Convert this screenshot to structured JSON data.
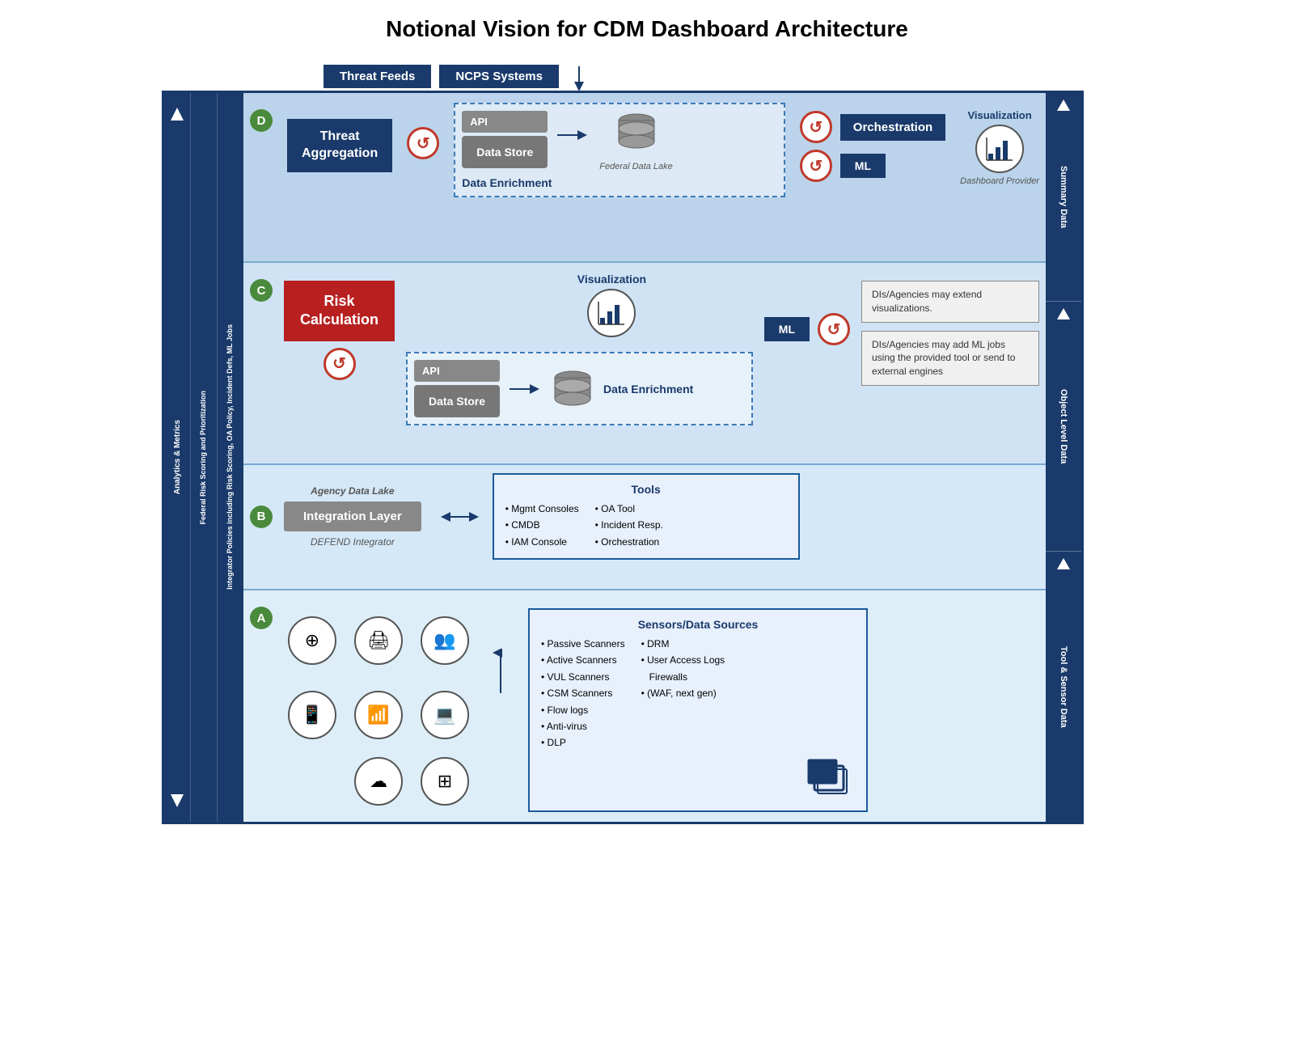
{
  "title": "Notional Vision for CDM Dashboard Architecture",
  "topFeeds": [
    {
      "label": "Threat Feeds"
    },
    {
      "label": "NCPS Systems"
    }
  ],
  "leftBars": [
    {
      "text": "Analytics & Metrics"
    },
    {
      "text": "Federal Risk Scoring and Prioritization"
    },
    {
      "text": "Integrator Policies including Risk Scoring, OA Policy, Incident Defs, ML Jobs"
    }
  ],
  "rightBars": [
    {
      "text": "Summary Data"
    },
    {
      "text": "Object Level Data"
    },
    {
      "text": "Tool & Sensor Data"
    }
  ],
  "sectionD": {
    "label": "D",
    "threatAggBox": "Threat\nAggregation",
    "apiLabel": "API",
    "dataStoreLabel": "Data\nStore",
    "dataEnrichmentLabel": "Data Enrichment",
    "orchestrationLabel": "Orchestration",
    "mlLabel": "ML",
    "federalDataLakeLabel": "Federal Data Lake",
    "visualizationLabel": "Visualization",
    "dashboardProviderLabel": "Dashboard Provider"
  },
  "sectionC": {
    "label": "C",
    "riskCalcLabel": "Risk\nCalculation",
    "visualizationLabel": "Visualization",
    "dataEnrichmentLabel": "Data Enrichment",
    "mlLabel": "ML",
    "apiLabel": "API",
    "dataStoreLabel": "Data\nStore",
    "note1": "DIs/Agencies may extend visualizations.",
    "note2": "DIs/Agencies may add ML jobs using the provided tool or send to external engines"
  },
  "sectionB": {
    "label": "B",
    "integrationLayerLabel": "Integration Layer",
    "agencyDataLakeLabel": "Agency Data Lake",
    "defendIntegratorLabel": "DEFEND Integrator",
    "tools": {
      "title": "Tools",
      "col1": [
        "Mgmt Consoles",
        "CMDB",
        "IAM Console"
      ],
      "col2": [
        "OA Tool",
        "Incident Resp.",
        "Orchestration"
      ]
    }
  },
  "sectionA": {
    "label": "A",
    "sensors": {
      "title": "Sensors/Data Sources",
      "col1": [
        "Passive Scanners",
        "Active Scanners",
        "VUL Scanners",
        "CSM Scanners",
        "Flow logs",
        "Anti-virus",
        "DLP"
      ],
      "col2": [
        "DRM",
        "User Access Logs",
        "Firewalls",
        "(WAF, next gen)"
      ]
    }
  }
}
